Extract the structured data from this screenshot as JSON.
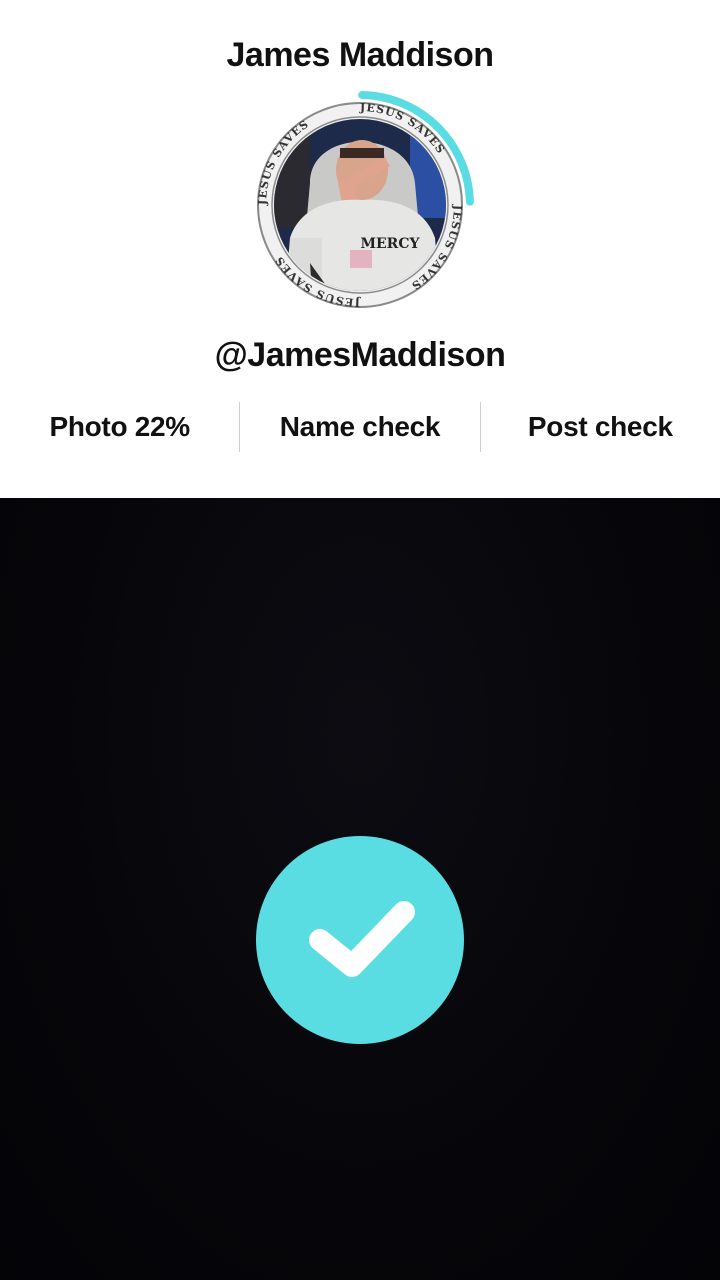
{
  "profile": {
    "display_name": "James Maddison",
    "username": "@JamesMaddison",
    "avatar_ring_text": "JESUS SAVES",
    "shirt_text": "MERCY"
  },
  "checks": {
    "photo_label": "Photo 22%",
    "photo_progress": 0.22,
    "name_label": "Name check",
    "post_label": "Post check"
  },
  "colors": {
    "accent": "#5ADDE2",
    "video_background": "#06060A",
    "panel_background": "#FFFFFF",
    "text": "#111111"
  },
  "icons": {
    "badge": "check-icon"
  }
}
